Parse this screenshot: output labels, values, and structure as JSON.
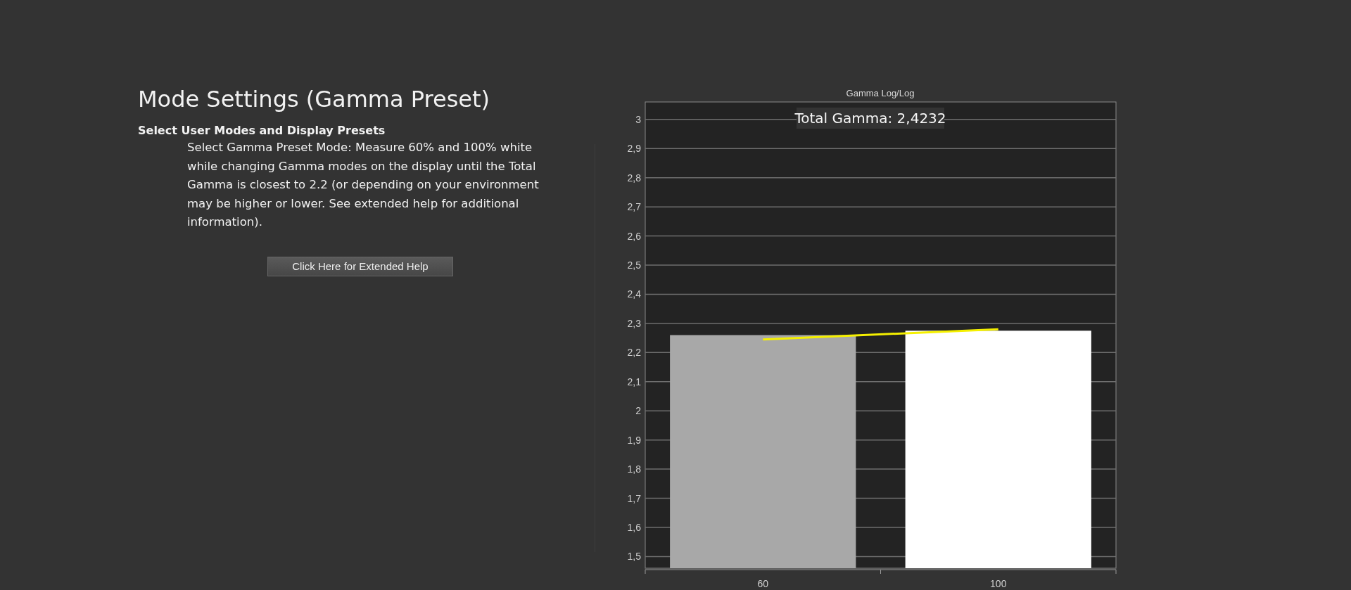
{
  "page": {
    "title": "Mode Settings (Gamma Preset)",
    "subtitle": "Select User Modes and Display Presets",
    "description": "Select Gamma Preset Mode: Measure 60% and 100% white while changing Gamma modes on the display until the Total Gamma is closest to 2.2 (or depending on your environment may be higher or lower. See extended help for additional information).",
    "help_button": "Click Here for Extended Help"
  },
  "chart": {
    "chart_data": {
      "type": "bar",
      "title": "Gamma Log/Log",
      "categories": [
        "60",
        "100"
      ],
      "grid": true,
      "series": [
        {
          "type": "bar",
          "colors": [
            "#a8a8a8",
            "#ffffff"
          ],
          "values": [
            2.26,
            2.275
          ]
        },
        {
          "type": "line",
          "color": "#f5f000",
          "values": [
            2.245,
            2.28
          ]
        }
      ],
      "ylim": [
        1.46,
        3.06
      ],
      "yticks": [
        {
          "value": 1.5,
          "label": "1,5"
        },
        {
          "value": 1.6,
          "label": "1,6"
        },
        {
          "value": 1.7,
          "label": "1,7"
        },
        {
          "value": 1.8,
          "label": "1,8"
        },
        {
          "value": 1.9,
          "label": "1,9"
        },
        {
          "value": 2,
          "label": "2"
        },
        {
          "value": 2.1,
          "label": "2,1"
        },
        {
          "value": 2.2,
          "label": "2,2"
        },
        {
          "value": 2.3,
          "label": "2,3"
        },
        {
          "value": 2.4,
          "label": "2,4"
        },
        {
          "value": 2.5,
          "label": "2,5"
        },
        {
          "value": 2.6,
          "label": "2,6"
        },
        {
          "value": 2.7,
          "label": "2,7"
        },
        {
          "value": 2.8,
          "label": "2,8"
        },
        {
          "value": 2.9,
          "label": "2,9"
        },
        {
          "value": 3,
          "label": "3"
        }
      ],
      "annotations": [
        {
          "text": "Total Gamma: 2,4232"
        }
      ]
    }
  }
}
